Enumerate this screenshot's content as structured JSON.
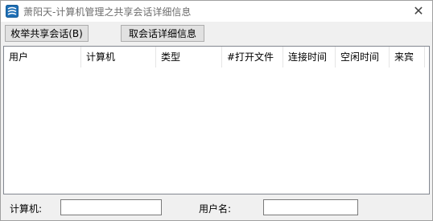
{
  "window": {
    "title": "萧阳天-计算机管理之共享会话详细信息",
    "close_glyph": "✕"
  },
  "toolbar": {
    "enum_label": "枚举共享会话(B)",
    "detail_label": "取会话详细信息"
  },
  "list": {
    "columns": [
      "用户",
      "计算机",
      "类型",
      "#打开文件",
      "连接时间",
      "空闲时间",
      "来宾"
    ],
    "rows": []
  },
  "bottom": {
    "computer_label": "计算机:",
    "computer_value": "",
    "user_label": "用户名:",
    "user_value": ""
  },
  "icons": [
    "app-icon",
    "close-icon"
  ]
}
